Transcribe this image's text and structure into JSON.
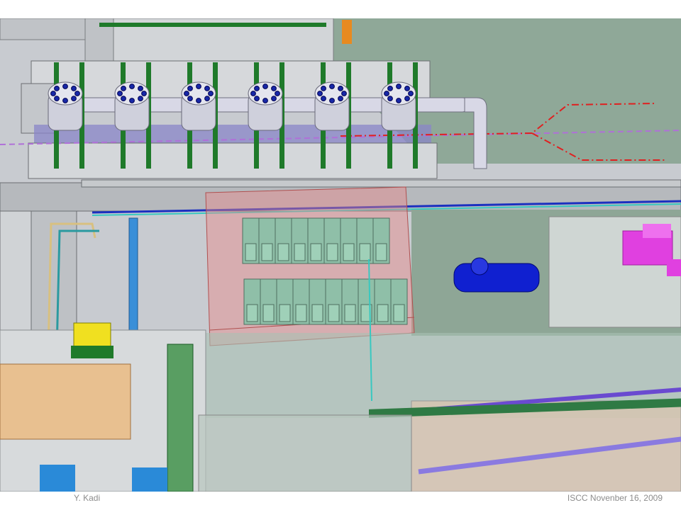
{
  "slide": {
    "footer_author": "Y. Kadi",
    "footer_event": "ISCC Novenber  16, 2009"
  },
  "colors": {
    "background": "#ffffff",
    "floor_green": "#8fa898",
    "concrete": "#c8cbd0",
    "cryomodule_support": "#1f7a2a",
    "pipe_blue": "#3a8fd8",
    "beam_line_red": "#e02020",
    "transparent_room_red": "#e88a8a",
    "tank_blue": "#1020d0",
    "magenta_block": "#e040e0",
    "box_tan": "#e8c090",
    "yellow_unit": "#f0e020",
    "rack_green": "#8fbfa8",
    "footer_text": "#8c8c8c"
  },
  "scene": {
    "cryomodule_count": 6,
    "rack_rows": [
      {
        "units": 9
      },
      {
        "units": 10
      }
    ]
  }
}
